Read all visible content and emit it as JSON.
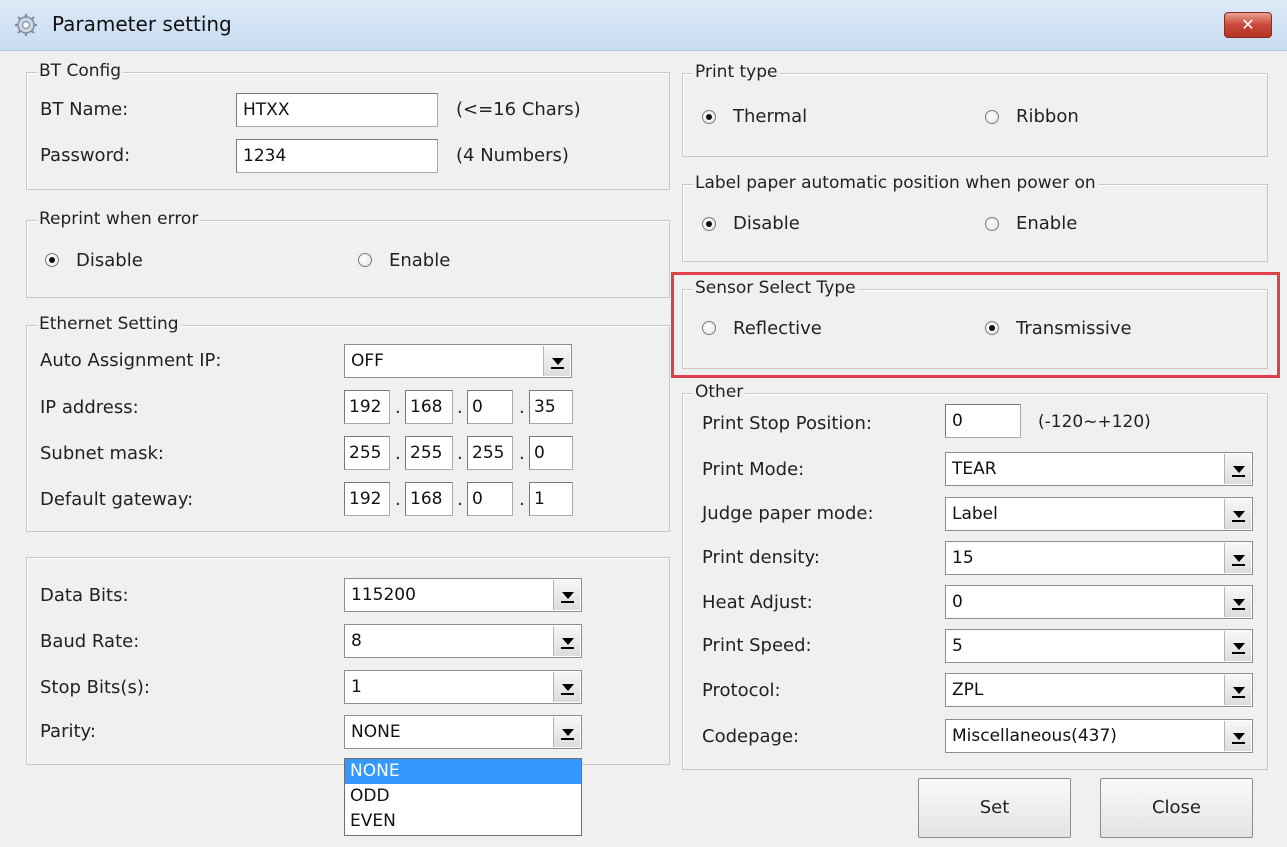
{
  "window": {
    "title": "Parameter setting",
    "close_symbol": "✕"
  },
  "bt_config": {
    "legend": "BT Config",
    "name_label": "BT Name:",
    "name_value": "HTXX",
    "name_hint": "(<=16 Chars)",
    "password_label": "Password:",
    "password_value": "1234",
    "password_hint": "(4 Numbers)"
  },
  "reprint": {
    "legend": "Reprint when error",
    "disable": "Disable",
    "enable": "Enable",
    "selected": "Disable"
  },
  "ethernet": {
    "legend": "Ethernet Setting",
    "auto_label": "Auto Assignment IP:",
    "auto_value": "OFF",
    "ip_label": "IP address:",
    "ip": [
      "192",
      "168",
      "0",
      "35"
    ],
    "subnet_label": "Subnet mask:",
    "subnet": [
      "255",
      "255",
      "255",
      "0"
    ],
    "gateway_label": "Default gateway:",
    "gateway": [
      "192",
      "168",
      "0",
      "1"
    ],
    "dot": "."
  },
  "serial": {
    "data_bits_label": "Data Bits:",
    "data_bits_value": "115200",
    "baud_label": "Baud Rate:",
    "baud_value": "8",
    "stop_label": "Stop Bits(s):",
    "stop_value": "1",
    "parity_label": "Parity:",
    "parity_value": "NONE",
    "parity_options": [
      "NONE",
      "ODD",
      "EVEN"
    ]
  },
  "print_type": {
    "legend": "Print type",
    "thermal": "Thermal",
    "ribbon": "Ribbon",
    "selected": "Thermal"
  },
  "label_paper": {
    "legend": "Label paper automatic position when power on",
    "disable": "Disable",
    "enable": "Enable",
    "selected": "Disable"
  },
  "sensor": {
    "legend": "Sensor Select Type",
    "reflective": "Reflective",
    "transmissive": "Transmissive",
    "selected": "Transmissive",
    "highlight_color": "#e0404a"
  },
  "other": {
    "legend": "Other",
    "stop_pos_label": "Print Stop Position:",
    "stop_pos_value": "0",
    "stop_pos_hint": "(-120~+120)",
    "mode_label": "Print Mode:",
    "mode_value": "TEAR",
    "judge_label": "Judge paper mode:",
    "judge_value": "Label",
    "density_label": "Print density:",
    "density_value": "15",
    "heat_label": "Heat Adjust:",
    "heat_value": "0",
    "speed_label": "Print Speed:",
    "speed_value": "5",
    "protocol_label": "Protocol:",
    "protocol_value": "ZPL",
    "codepage_label": "Codepage:",
    "codepage_value": "Miscellaneous(437)"
  },
  "buttons": {
    "set": "Set",
    "close": "Close"
  }
}
